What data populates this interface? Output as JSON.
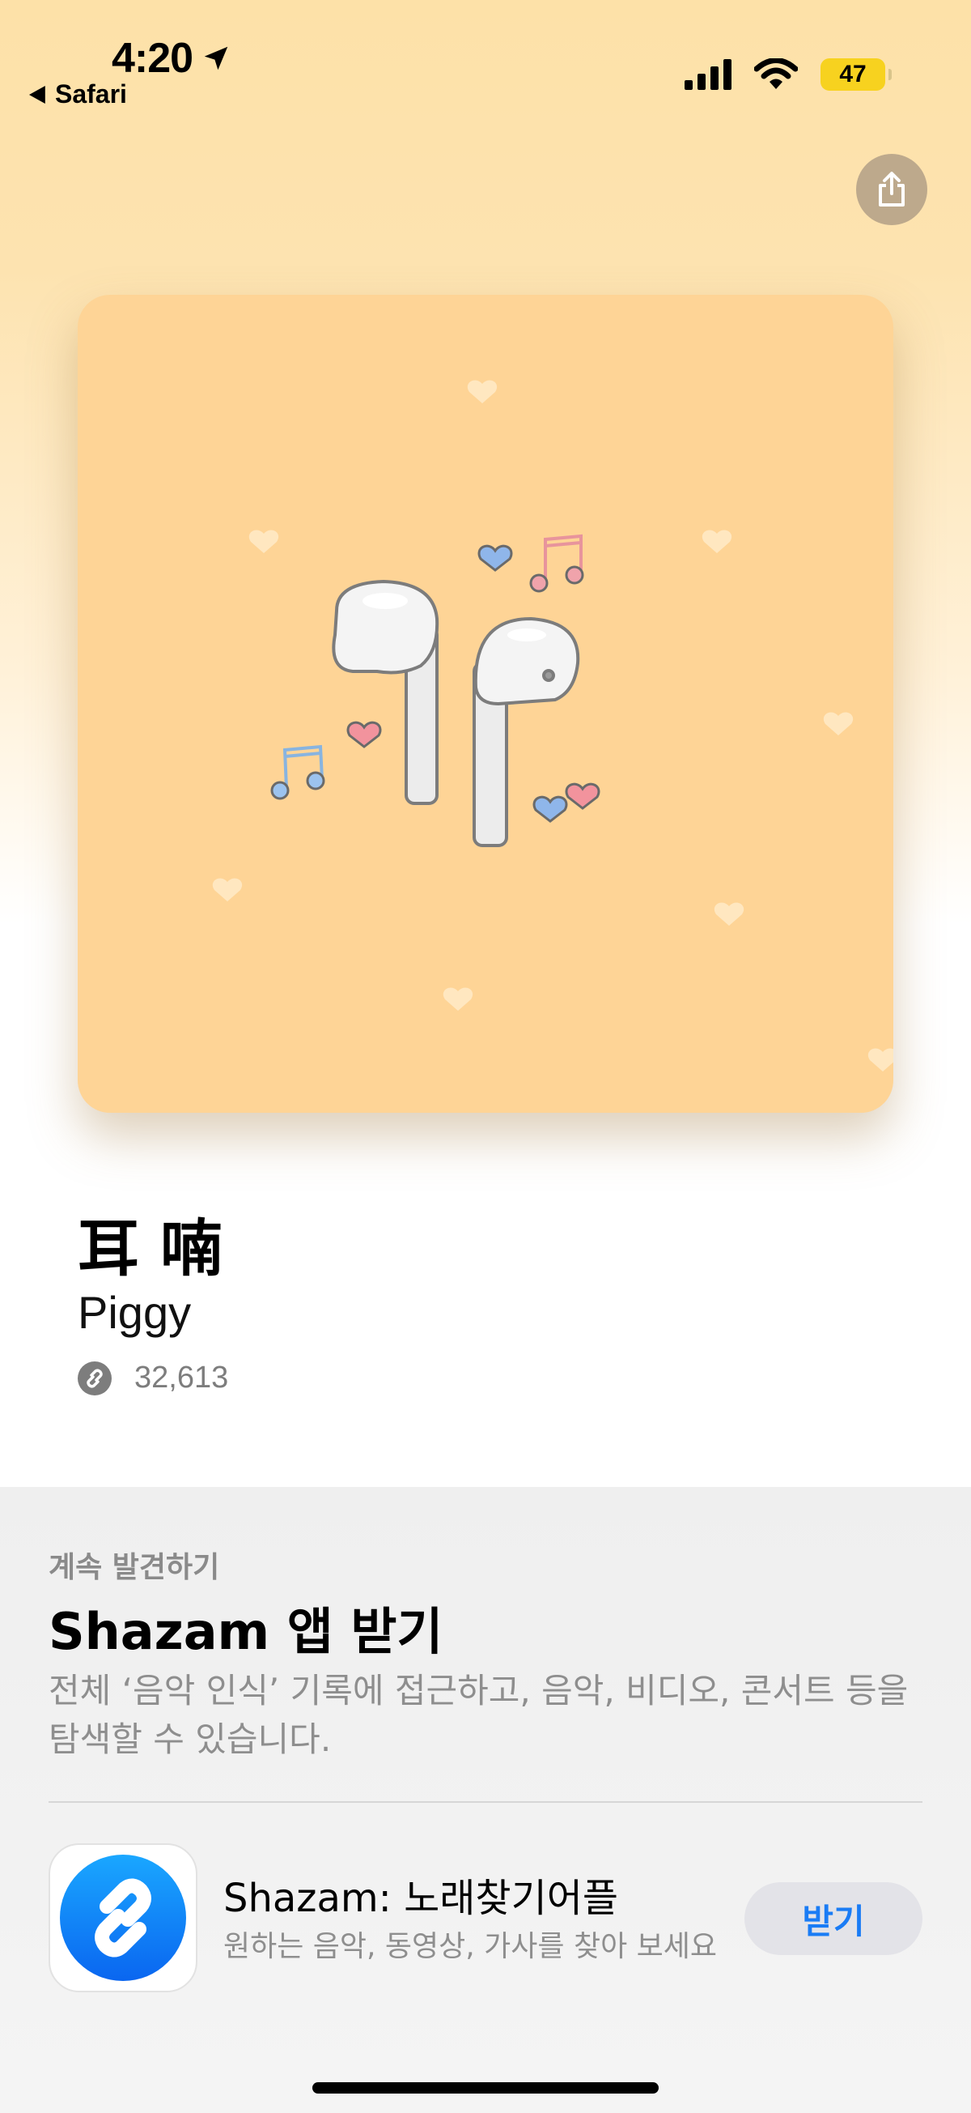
{
  "status_bar": {
    "time": "4:20",
    "back_label": "Safari",
    "battery": "47"
  },
  "song": {
    "title": "耳 喃",
    "artist": "Piggy",
    "play_count": "32,613"
  },
  "promo": {
    "eyebrow": "계속 발견하기",
    "title": "Shazam 앱 받기",
    "description": "전체 ‘음악 인식’ 기록에 접근하고, 음악, 비디오, 콘서트 등을 탐색할 수 있습니다.",
    "app_name": "Shazam: 노래찾기어플",
    "app_subtitle": "원하는 음악, 동영상, 가사를 찾아 보세요",
    "get_label": "받기"
  },
  "colors": {
    "accent": "#1a7cf5",
    "artwork_bg": "#fed496",
    "battery": "#f7d21f"
  },
  "icons": [
    "location-arrow-icon",
    "back-triangle-icon",
    "cellular-signal-icon",
    "wifi-icon",
    "battery-icon",
    "share-icon",
    "shazam-icon"
  ]
}
